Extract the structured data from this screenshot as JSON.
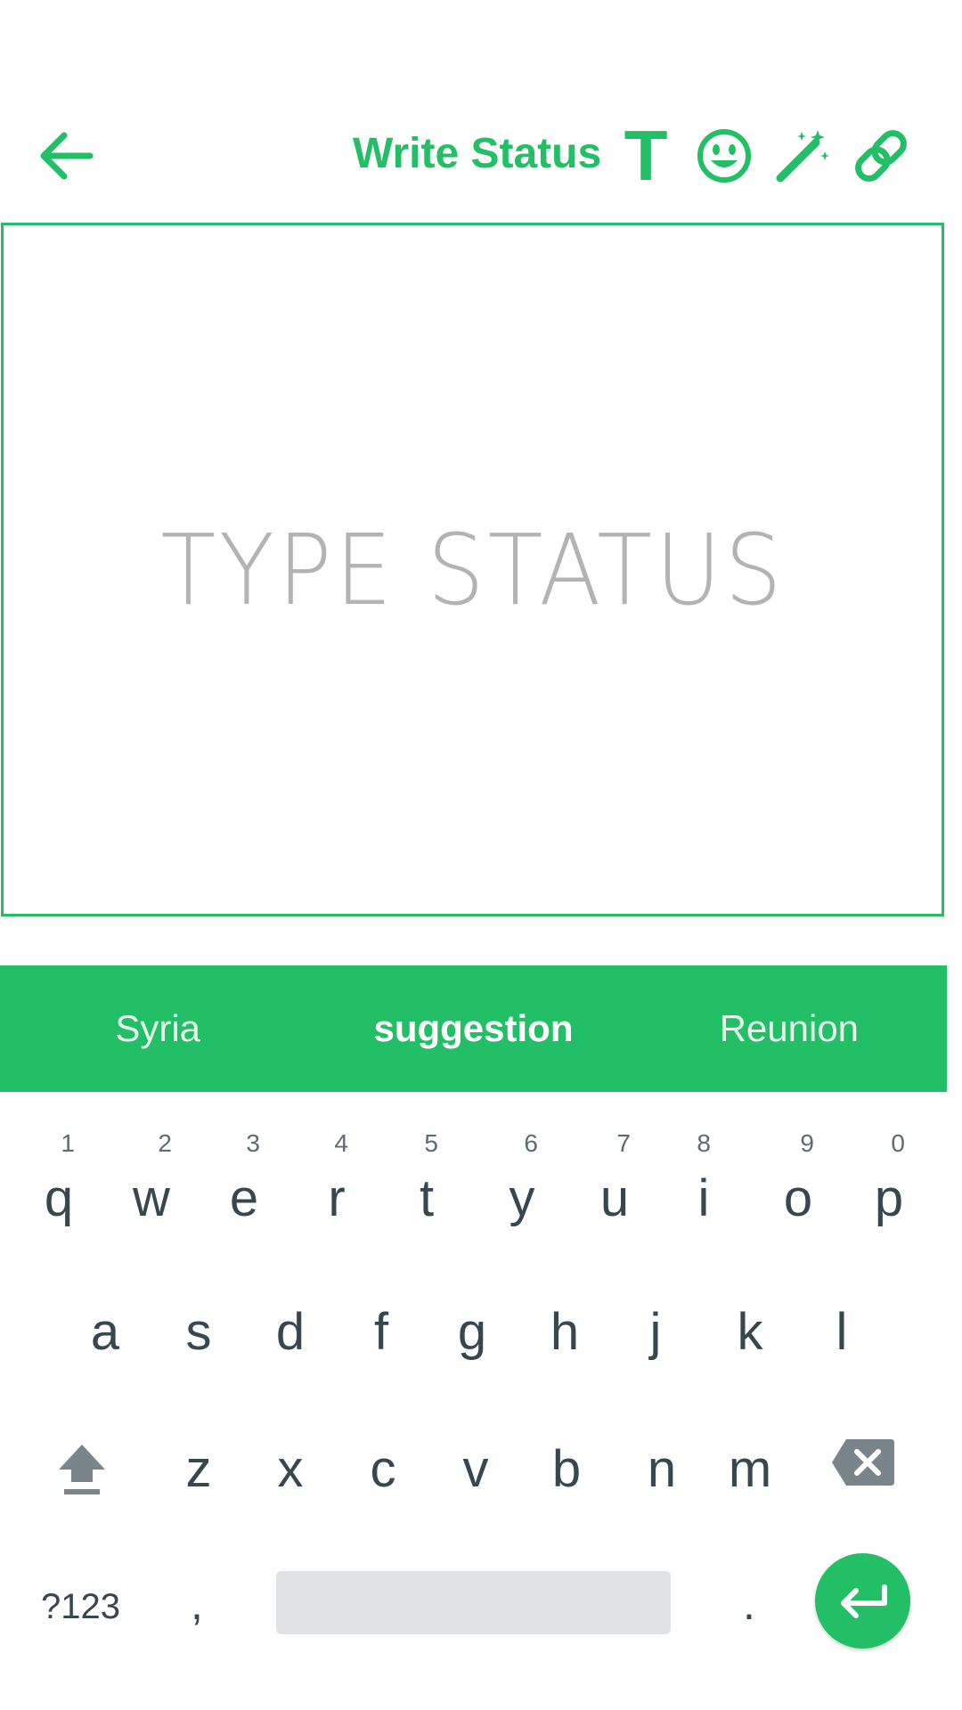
{
  "toolbar": {
    "title": "Write Status",
    "accent": "#22bf67",
    "icons": [
      "back-arrow-icon",
      "text-format-icon",
      "emoji-icon",
      "magic-wand-icon",
      "link-icon"
    ],
    "text_tool_label": "T"
  },
  "editor": {
    "placeholder": "TYPE STATUS"
  },
  "suggestions": [
    "Syria",
    "suggestion",
    "Reunion"
  ],
  "keyboard": {
    "row1": [
      {
        "label": "q",
        "num": "1"
      },
      {
        "label": "w",
        "num": "2"
      },
      {
        "label": "e",
        "num": "3"
      },
      {
        "label": "r",
        "num": "4"
      },
      {
        "label": "t",
        "num": "5"
      },
      {
        "label": "y",
        "num": "6"
      },
      {
        "label": "u",
        "num": "7"
      },
      {
        "label": "i",
        "num": "8"
      },
      {
        "label": "o",
        "num": "9"
      },
      {
        "label": "p",
        "num": "0"
      }
    ],
    "row2": [
      "a",
      "s",
      "d",
      "f",
      "g",
      "h",
      "j",
      "k",
      "l"
    ],
    "row3": [
      "z",
      "x",
      "c",
      "v",
      "b",
      "n",
      "m"
    ],
    "symbols_label": "?123",
    "comma_label": ",",
    "period_label": "."
  }
}
